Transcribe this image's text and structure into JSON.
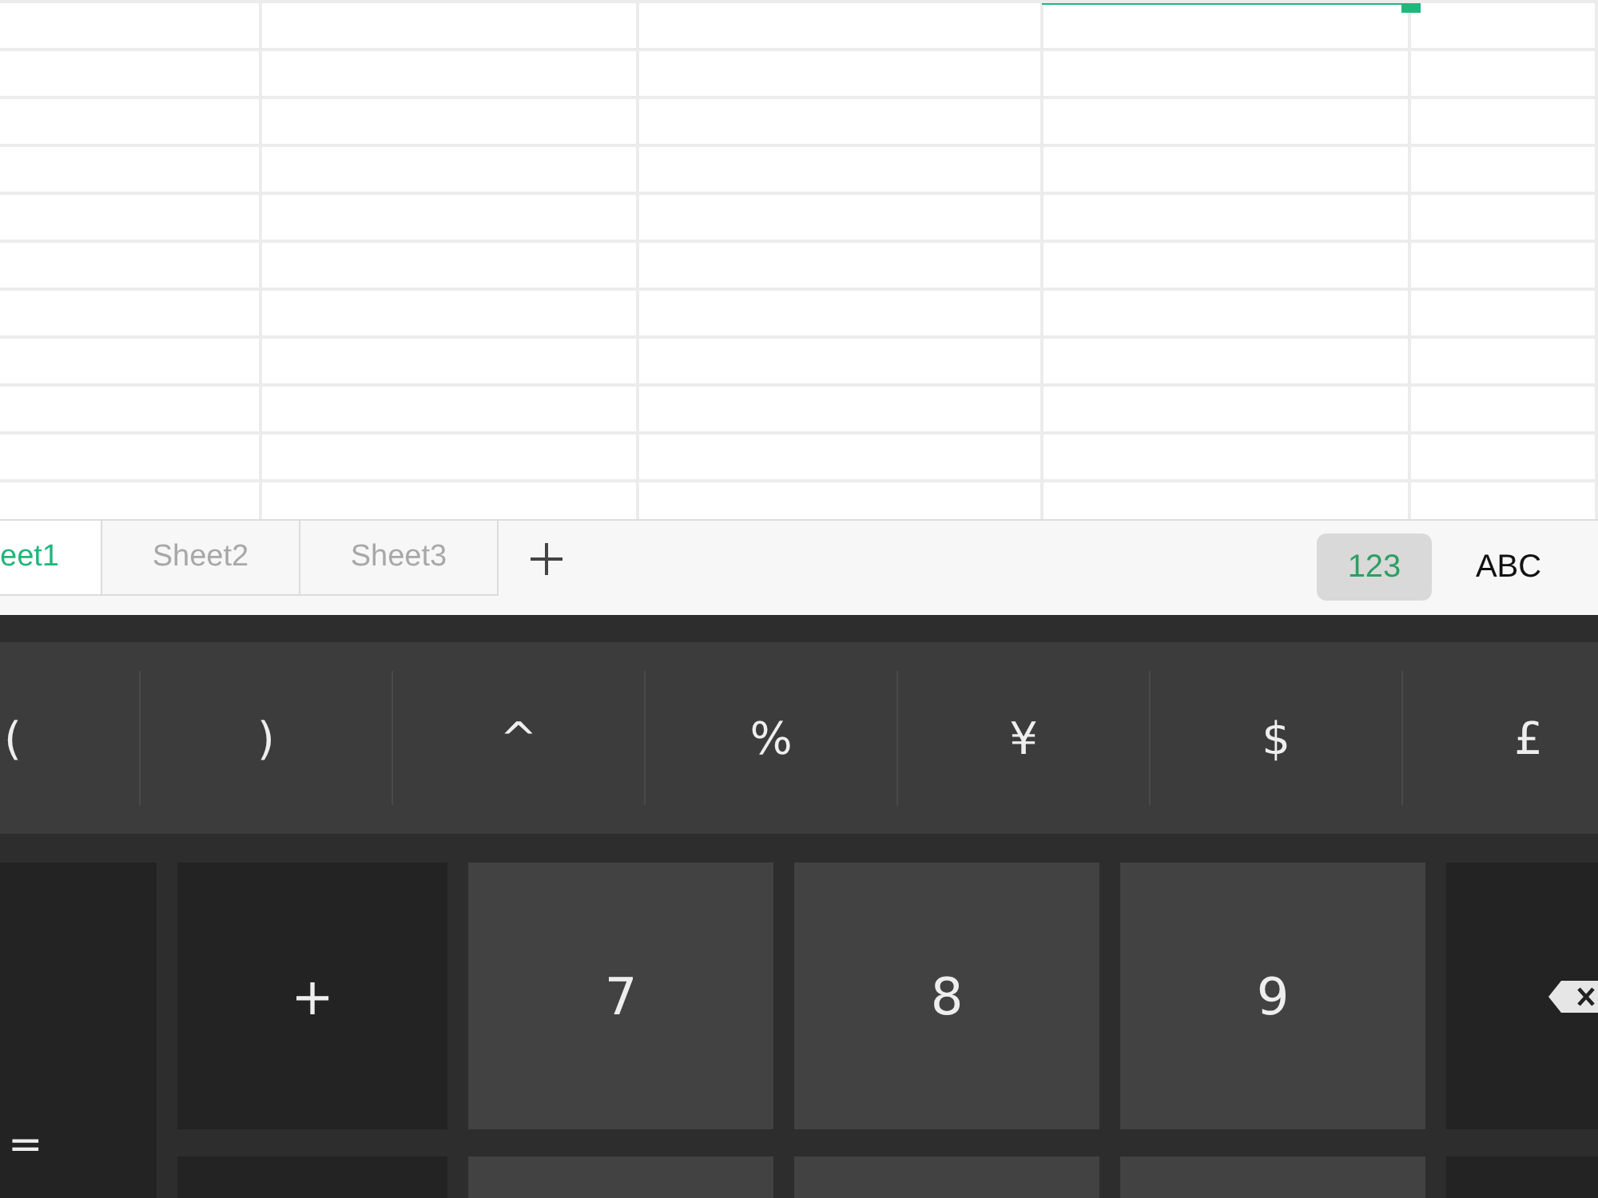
{
  "sheet_tabs": [
    {
      "label": "eet1",
      "selected": true
    },
    {
      "label": "Sheet2",
      "selected": false
    },
    {
      "label": "Sheet3",
      "selected": false
    }
  ],
  "input_modes": [
    {
      "label": "123",
      "selected": true
    },
    {
      "label": "ABC",
      "selected": false
    }
  ],
  "symbol_keys": [
    "(",
    ")",
    "^",
    "%",
    "¥",
    "$",
    "£"
  ],
  "side_key": "=",
  "keys": [
    {
      "kind": "operator",
      "label": "+"
    },
    {
      "kind": "digit",
      "label": "7"
    },
    {
      "kind": "digit",
      "label": "8"
    },
    {
      "kind": "digit",
      "label": "9"
    },
    {
      "kind": "backspace"
    }
  ]
}
